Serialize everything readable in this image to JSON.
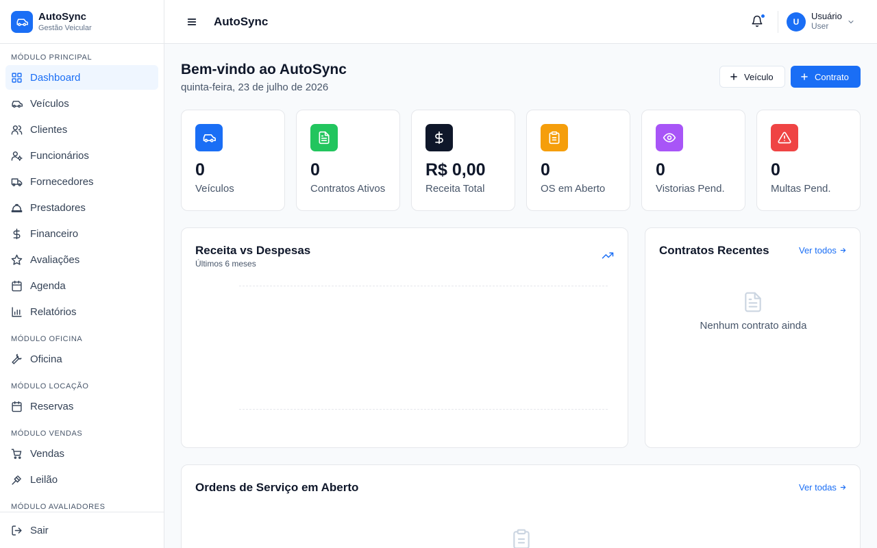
{
  "brand": {
    "title": "AutoSync",
    "subtitle": "Gestão Veicular",
    "color": "#1a6ef5"
  },
  "sidebar": {
    "sections": [
      {
        "title": "Módulo Principal",
        "items": [
          {
            "label": "Dashboard",
            "icon": "dashboard-icon",
            "active": true
          },
          {
            "label": "Veículos",
            "icon": "car-icon"
          },
          {
            "label": "Clientes",
            "icon": "users-icon"
          },
          {
            "label": "Funcionários",
            "icon": "user-cog-icon"
          },
          {
            "label": "Fornecedores",
            "icon": "truck-icon"
          },
          {
            "label": "Prestadores",
            "icon": "hard-hat-icon"
          },
          {
            "label": "Financeiro",
            "icon": "dollar-icon"
          },
          {
            "label": "Avaliações",
            "icon": "star-icon"
          },
          {
            "label": "Agenda",
            "icon": "calendar-icon"
          },
          {
            "label": "Relatórios",
            "icon": "bar-chart-icon"
          }
        ]
      },
      {
        "title": "Módulo Oficina",
        "items": [
          {
            "label": "Oficina",
            "icon": "wrench-icon"
          }
        ]
      },
      {
        "title": "Módulo Locação",
        "items": [
          {
            "label": "Reservas",
            "icon": "calendar-icon"
          }
        ]
      },
      {
        "title": "Módulo Vendas",
        "items": [
          {
            "label": "Vendas",
            "icon": "cart-icon"
          },
          {
            "label": "Leilão",
            "icon": "gavel-icon"
          }
        ]
      },
      {
        "title": "Módulo Avaliadores",
        "items": []
      }
    ],
    "logout_label": "Sair"
  },
  "header": {
    "title": "AutoSync",
    "user_initial": "U",
    "user_name": "Usuário",
    "user_role": "User"
  },
  "welcome": {
    "title": "Bem-vindo ao AutoSync",
    "date": "quinta-feira, 23 de julho de 2026"
  },
  "actions": {
    "vehicle_label": "Veículo",
    "contract_label": "Contrato"
  },
  "stats": [
    {
      "value": "0",
      "label": "Veículos",
      "color": "#1a6ef5",
      "icon": "car-icon"
    },
    {
      "value": "0",
      "label": "Contratos Ativos",
      "color": "#22c55e",
      "icon": "file-text-icon"
    },
    {
      "value": "R$ 0,00",
      "label": "Receita Total",
      "color": "#0f172a",
      "icon": "dollar-icon"
    },
    {
      "value": "0",
      "label": "OS em Aberto",
      "color": "#f59e0b",
      "icon": "clipboard-icon"
    },
    {
      "value": "0",
      "label": "Vistorias Pend.",
      "color": "#a855f7",
      "icon": "eye-icon"
    },
    {
      "value": "0",
      "label": "Multas Pend.",
      "color": "#ef4444",
      "icon": "alert-triangle-icon"
    }
  ],
  "revenue_card": {
    "title": "Receita vs Despesas",
    "subtitle": "Últimos 6 meses",
    "icon": "trending-up-icon"
  },
  "contracts_card": {
    "title": "Contratos Recentes",
    "see_all": "Ver todos",
    "empty_text": "Nenhum contrato ainda",
    "empty_icon": "file-text-icon"
  },
  "orders_card": {
    "title": "Ordens de Serviço em Aberto",
    "see_all": "Ver todas",
    "empty_icon": "clipboard-icon"
  }
}
